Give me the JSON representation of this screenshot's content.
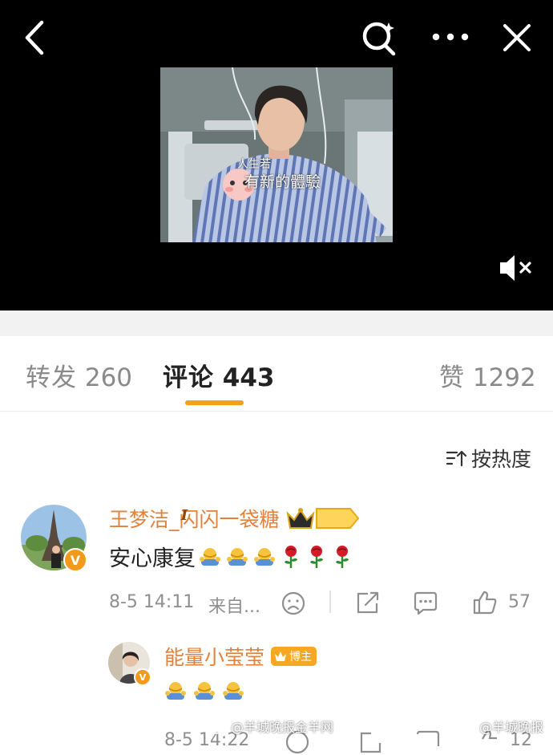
{
  "video": {
    "overlay_line1": "人生若",
    "overlay_line2": "有新的體驗"
  },
  "tabs": [
    {
      "label": "转发",
      "count": "260"
    },
    {
      "label": "评论",
      "count": "443"
    },
    {
      "label": "赞",
      "count": "1292"
    }
  ],
  "sort": {
    "label": "按热度"
  },
  "comments": [
    {
      "username": "王梦洁_闪闪一袋糖",
      "level_badge": "I",
      "text": "安心康复",
      "date": "8-5 14:11",
      "source": "来自...",
      "likes": "57",
      "emojis": [
        "hug-emoji",
        "hug-emoji",
        "hug-emoji",
        "rose-emoji",
        "rose-emoji",
        "rose-emoji"
      ]
    },
    {
      "username": "能量小莹莹",
      "role_badge": "博主",
      "emojis": [
        "hug-emoji",
        "hug-emoji",
        "hug-emoji"
      ],
      "date": "8-5 14:22",
      "likes": "12"
    }
  ],
  "watermarks": {
    "left": "@羊城晚报金羊网",
    "right": "@羊城晚报"
  },
  "colors": {
    "accent_orange": "#f4a018",
    "username_orange": "#e0823c",
    "verified_badge": "#f39a1c"
  }
}
